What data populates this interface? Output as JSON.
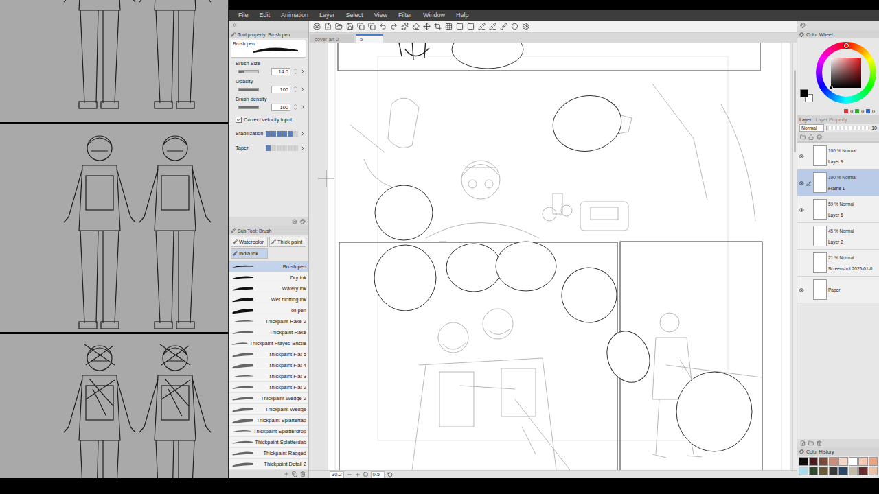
{
  "menu": [
    "File",
    "Edit",
    "Animation",
    "Layer",
    "Select",
    "View",
    "Filter",
    "Window",
    "Help"
  ],
  "tool_property": {
    "title": "Tool property: Brush pen",
    "preview_label": "Brush pen",
    "fields": [
      {
        "kind": "slider",
        "label": "Brush Size",
        "value": "14.0",
        "level": 0.25
      },
      {
        "kind": "slider",
        "label": "Opacity",
        "value": "100",
        "level": 1
      },
      {
        "kind": "slider",
        "label": "Brush density",
        "value": "100",
        "level": 1
      },
      {
        "kind": "checkbox",
        "label": "Correct velocity input",
        "checked": true
      },
      {
        "kind": "segments",
        "label": "Stabilization",
        "level": 0.83
      },
      {
        "kind": "segments",
        "label": "Taper",
        "level": 0.17
      }
    ]
  },
  "sub_tool": {
    "title": "Sub Tool: Brush",
    "groups": [
      {
        "label": "Watercolor",
        "selected": false
      },
      {
        "label": "Thick paint",
        "selected": false
      },
      {
        "label": "India ink",
        "selected": true
      }
    ],
    "brushes": [
      {
        "label": "Brush pen",
        "selected": true
      },
      {
        "label": "Dry ink",
        "selected": false
      },
      {
        "label": "Watery ink",
        "selected": false
      },
      {
        "label": "Wet blotting ink",
        "selected": false
      },
      {
        "label": "oil pen",
        "selected": false
      },
      {
        "label": "Thickpaint Rake 2",
        "selected": false
      },
      {
        "label": "Thickpaint Rake",
        "selected": false
      },
      {
        "label": "Thickpaint Frayed Bristle",
        "selected": false
      },
      {
        "label": "Thickpaint Flat 5",
        "selected": false
      },
      {
        "label": "Thickpaint Flat 4",
        "selected": false
      },
      {
        "label": "Thickpaint Flat 3",
        "selected": false
      },
      {
        "label": "Thickpaint Flat 2",
        "selected": false
      },
      {
        "label": "Thickpaint Wedge 2",
        "selected": false
      },
      {
        "label": "Thickpaint Wedge",
        "selected": false
      },
      {
        "label": "Thickpaint Splattertap",
        "selected": false
      },
      {
        "label": "Thickpaint Splatterdrop",
        "selected": false
      },
      {
        "label": "Thickpaint Splatterdab",
        "selected": false
      },
      {
        "label": "Thickpaint Ragged",
        "selected": false
      },
      {
        "label": "Thickpaint Detail 2",
        "selected": false
      }
    ]
  },
  "document_tabs": [
    {
      "label": "cover art 2",
      "selected": false
    },
    {
      "label": "5",
      "selected": true
    }
  ],
  "status_bar": {
    "zoom": "30.2",
    "rotation": "0.5"
  },
  "color_wheel": {
    "title": "Color Wheel",
    "main_color": "#000000",
    "sub_color": "#ffffff",
    "hue_color": "#e8141b",
    "rgb": [
      "0",
      "0",
      "0"
    ]
  },
  "layer_panel": {
    "title": "Layer",
    "property_tab": "Layer Property",
    "blend_mode": "Normal",
    "opacity": "10",
    "layers": [
      {
        "name": "Layer 9",
        "mode": "100 % Normal",
        "visible": true,
        "selected": false
      },
      {
        "name": "Frame 1",
        "mode": "100 % Normal",
        "visible": true,
        "selected": true
      },
      {
        "name": "Layer 6",
        "mode": "59 % Normal",
        "visible": true,
        "selected": false
      },
      {
        "name": "Layer 2",
        "mode": "45 % Normal",
        "visible": false,
        "selected": false
      },
      {
        "name": "Screenshot 2025-01-0",
        "mode": "21 % Normal",
        "visible": false,
        "selected": false
      },
      {
        "name": "Paper",
        "visible": true,
        "selected": false
      }
    ]
  },
  "color_history": {
    "title": "Color History",
    "swatches": [
      {
        "color": "#0d0d0d"
      },
      {
        "color": "#4a1c1c"
      },
      {
        "color": "#7a4a3a"
      },
      {
        "color": "#c98f78"
      },
      {
        "color": "#f4d5c6"
      },
      {
        "color": "#ffffff"
      },
      {
        "color": "#f6c9b4"
      },
      {
        "color": "#e7a487"
      },
      {
        "color": "#a9dcea"
      },
      {
        "color": "#2f4a2a"
      },
      {
        "color": "#6c5a3a"
      },
      {
        "color": "#3a3a3a"
      },
      {
        "color": "#2b4868"
      },
      {
        "color": "#c2b8a8"
      },
      {
        "color": "#6a2e2e"
      },
      {
        "color": "#e9c1a8"
      }
    ]
  }
}
